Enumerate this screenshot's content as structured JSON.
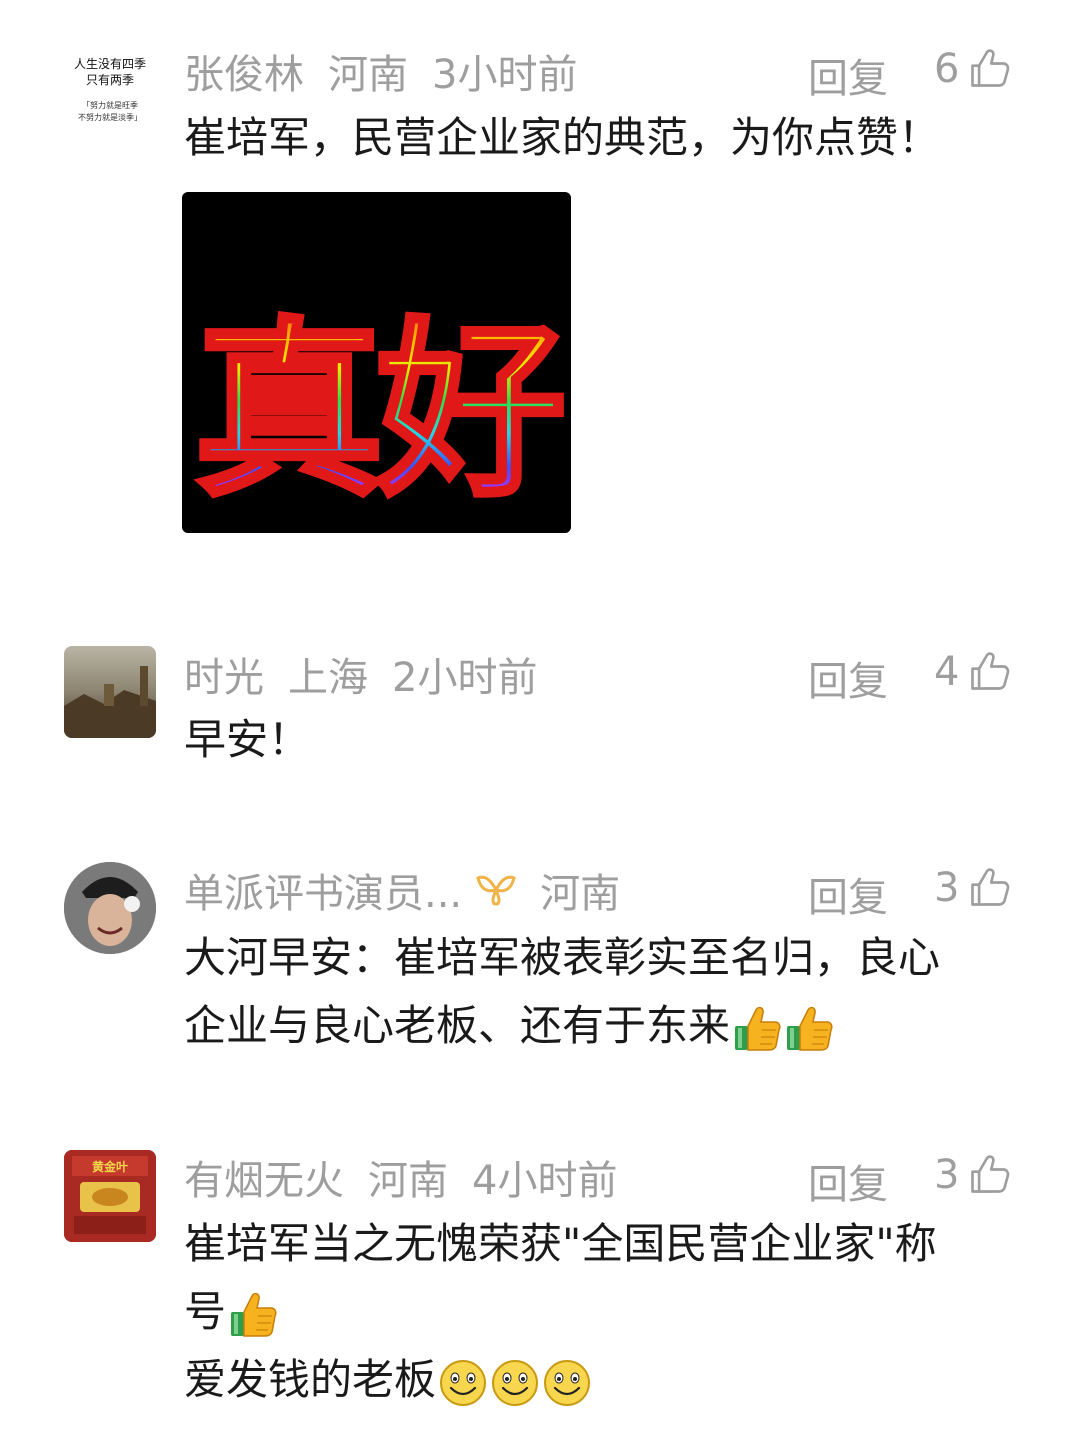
{
  "comments": [
    {
      "user": "张俊林",
      "location": "河南",
      "time": "3小时前",
      "reply_label": "回复",
      "likes": "6",
      "text": "崔培军，民营企业家的典范，为你点赞！",
      "avatar_text": [
        "人生没有四季",
        "只有两季",
        "「努力就是旺季",
        "不努力就是淡季」"
      ],
      "sticker_text": "真好"
    },
    {
      "user": "时光",
      "location": "上海",
      "time": "2小时前",
      "reply_label": "回复",
      "likes": "4",
      "text": "早安！"
    },
    {
      "user": "单派评书演员...",
      "location": "河南",
      "reply_label": "回复",
      "likes": "3",
      "text_line1": "大河早安：崔培军被表彰实至名归，良心",
      "text_line2": "企业与良心老板、还有于东来"
    },
    {
      "user": "有烟无火",
      "location": "河南",
      "time": "4小时前",
      "reply_label": "回复",
      "likes": "3",
      "text_line1": "崔培军当之无愧荣获\"全国民营企业家\"称",
      "text_line2": "号",
      "text_line3": "爱发钱的老板"
    }
  ],
  "icons": {
    "like": "thumbs-up-outline-icon",
    "badge": "ribbon-badge-icon",
    "emoji_thumb": "thumbs-up-emoji",
    "emoji_smile": "smile-emoji"
  },
  "colors": {
    "meta_text": "#9e9e9e",
    "body_text": "#1a1a1a",
    "badge": "#f0b34a"
  }
}
